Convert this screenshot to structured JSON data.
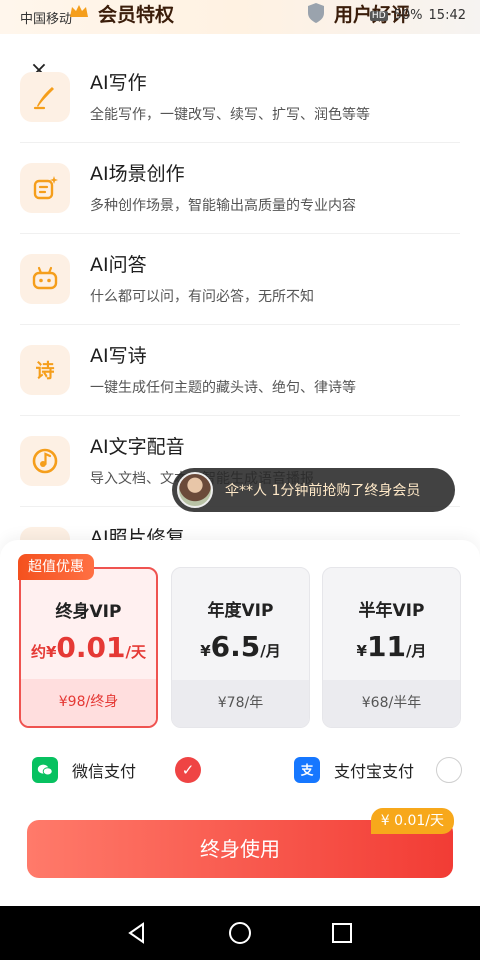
{
  "status": {
    "carrier": "中国移动",
    "hd": "HD",
    "battery": "50%",
    "time": "15:42"
  },
  "header": {
    "left_title": "会员特权",
    "right_title": "用户好评"
  },
  "close_label": "×",
  "features": [
    {
      "title": "AI写作",
      "desc": "全能写作，一键改写、续写、扩写、润色等等",
      "icon": "pen-icon"
    },
    {
      "title": "AI场景创作",
      "desc": "多种创作场景，智能输出高质量的专业内容",
      "icon": "sparkle-doc-icon"
    },
    {
      "title": "AI问答",
      "desc": "什么都可以问，有问必答，无所不知",
      "icon": "chat-bot-icon"
    },
    {
      "title": "AI写诗",
      "desc": "一键生成任何主题的藏头诗、绝句、律诗等",
      "icon": "poem-icon"
    },
    {
      "title": "AI文字配音",
      "desc": "导入文档、文本，智能生成语音播报",
      "icon": "music-disc-icon"
    },
    {
      "title": "AI照片修复",
      "desc": "",
      "icon": "photo-icon"
    }
  ],
  "toast": {
    "text": "伞**人  1分钟前抢购了终身会员"
  },
  "plans": [
    {
      "name": "终身VIP",
      "prefix": "约¥",
      "price": "0.01",
      "unit": "/天",
      "footer": "¥98/终身",
      "selected": true
    },
    {
      "name": "年度VIP",
      "prefix": "¥",
      "price": "6.5",
      "unit": "/月",
      "footer": "¥78/年",
      "selected": false
    },
    {
      "name": "半年VIP",
      "prefix": "¥",
      "price": "11",
      "unit": "/月",
      "footer": "¥68/半年",
      "selected": false
    }
  ],
  "badge": "超值优惠",
  "payment": {
    "wechat": "微信支付",
    "alipay": "支付宝支付"
  },
  "cta": {
    "label": "终身使用",
    "tag": "¥ 0.01/天"
  },
  "colors": {
    "accent": "#ef4444",
    "icon_orange": "#f59e1b",
    "wechat_green": "#07c160",
    "alipay_blue": "#1677ff"
  }
}
